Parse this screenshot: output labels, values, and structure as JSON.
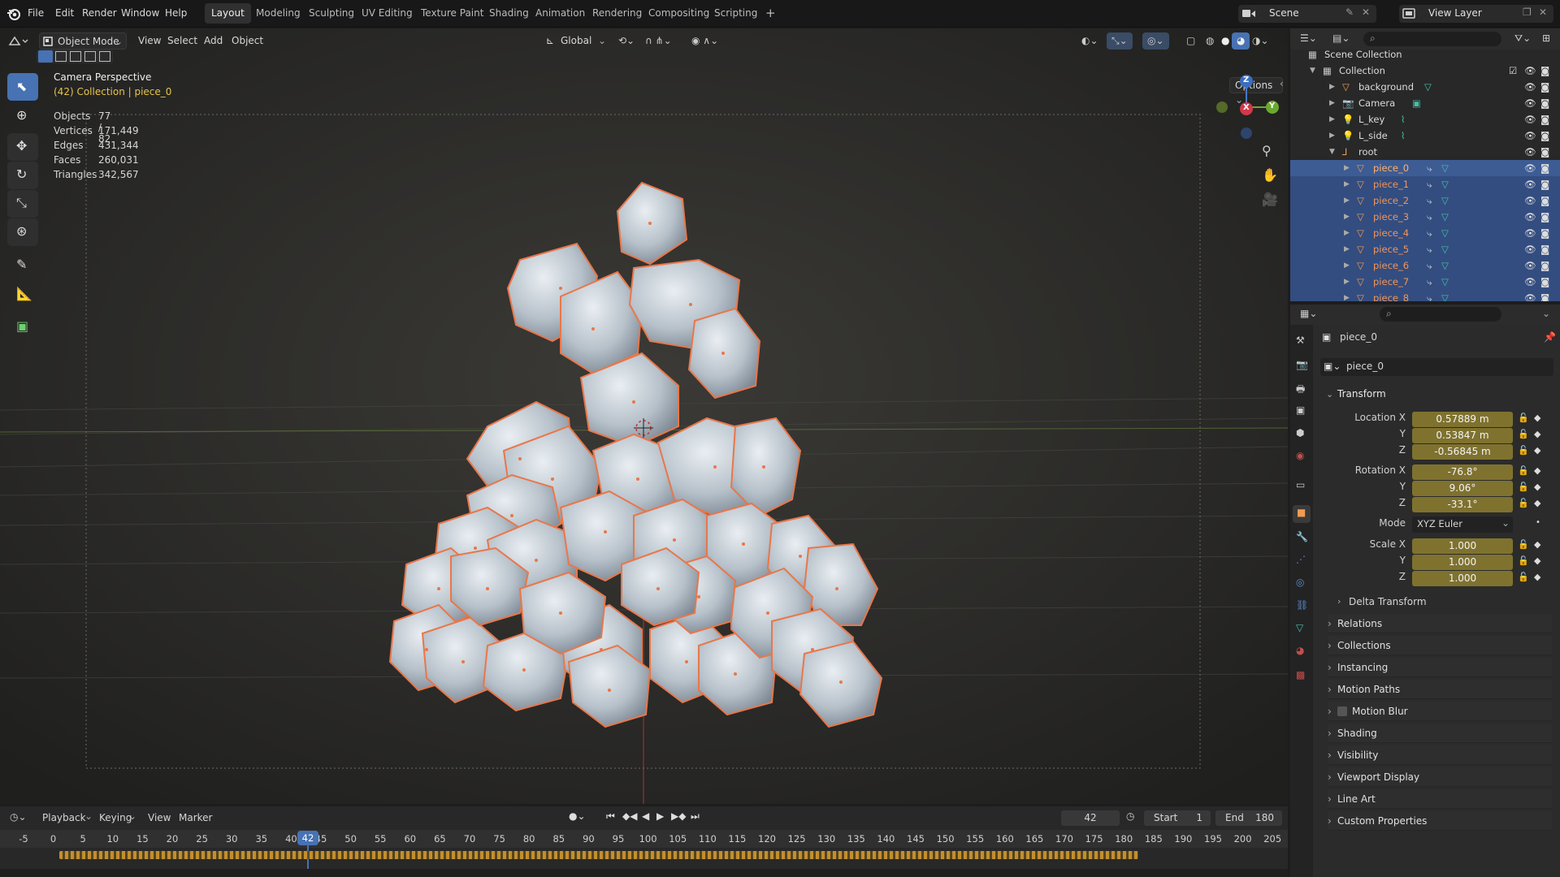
{
  "topbar": {
    "menus": [
      "File",
      "Edit",
      "Render",
      "Window",
      "Help"
    ],
    "workspaces": [
      "Layout",
      "Modeling",
      "Sculpting",
      "UV Editing",
      "Texture Paint",
      "Shading",
      "Animation",
      "Rendering",
      "Compositing",
      "Scripting"
    ],
    "active_workspace": "Layout",
    "add_tab": "+",
    "scene_label": "Scene",
    "view_layer_label": "View Layer"
  },
  "viewport_header": {
    "mode": "Object Mode",
    "menus": [
      "View",
      "Select",
      "Add",
      "Object"
    ],
    "orientation": "Global",
    "options": "Options"
  },
  "viewport": {
    "camera_title": "Camera Perspective",
    "collection_line": "(42) Collection | piece_0",
    "stats": [
      {
        "label": "Objects",
        "value": "77 / 82"
      },
      {
        "label": "Vertices",
        "value": "171,449"
      },
      {
        "label": "Edges",
        "value": "431,344"
      },
      {
        "label": "Faces",
        "value": "260,031"
      },
      {
        "label": "Triangles",
        "value": "342,567"
      }
    ],
    "gizmo": {
      "x": "X",
      "y": "Y",
      "z": "Z"
    }
  },
  "outliner": {
    "scene_collection": "Scene Collection",
    "collection": "Collection",
    "items": [
      {
        "name": "background",
        "type": "mesh"
      },
      {
        "name": "Camera",
        "type": "camera"
      },
      {
        "name": "L_key",
        "type": "light"
      },
      {
        "name": "L_side",
        "type": "light"
      },
      {
        "name": "root",
        "type": "empty"
      },
      {
        "name": "piece_0",
        "type": "mesh"
      },
      {
        "name": "piece_1",
        "type": "mesh"
      },
      {
        "name": "piece_2",
        "type": "mesh"
      },
      {
        "name": "piece_3",
        "type": "mesh"
      },
      {
        "name": "piece_4",
        "type": "mesh"
      },
      {
        "name": "piece_5",
        "type": "mesh"
      },
      {
        "name": "piece_6",
        "type": "mesh"
      },
      {
        "name": "piece_7",
        "type": "mesh"
      },
      {
        "name": "piece_8",
        "type": "mesh"
      }
    ]
  },
  "properties": {
    "object_name": "piece_0",
    "data_name": "piece_0",
    "transform_title": "Transform",
    "location": {
      "label": "Location X",
      "x": "0.57889 m",
      "y": "0.53847 m",
      "z": "-0.56845 m"
    },
    "rotation": {
      "label": "Rotation X",
      "x": "-76.8°",
      "y": "9.06°",
      "z": "-33.1°"
    },
    "mode_label": "Mode",
    "mode_value": "XYZ Euler",
    "scale": {
      "label": "Scale X",
      "x": "1.000",
      "y": "1.000",
      "z": "1.000"
    },
    "axis_y": "Y",
    "axis_z": "Z",
    "delta": "Delta Transform",
    "sections": [
      "Relations",
      "Collections",
      "Instancing",
      "Motion Paths",
      "Motion Blur",
      "Shading",
      "Visibility",
      "Viewport Display",
      "Line Art",
      "Custom Properties"
    ]
  },
  "timeline": {
    "menus": [
      "Playback",
      "Keying",
      "View",
      "Marker"
    ],
    "current_frame": "42",
    "start_label": "Start",
    "start_value": "1",
    "end_label": "End",
    "end_value": "180",
    "ruler": [
      "-5",
      "0",
      "5",
      "10",
      "15",
      "20",
      "25",
      "30",
      "35",
      "40",
      "45",
      "50",
      "55",
      "60",
      "65",
      "70",
      "75",
      "80",
      "85",
      "90",
      "95",
      "100",
      "105",
      "110",
      "115",
      "120",
      "125",
      "130",
      "135",
      "140",
      "145",
      "150",
      "155",
      "160",
      "165",
      "170",
      "175",
      "180",
      "185",
      "190",
      "195",
      "200",
      "205"
    ]
  },
  "colors": {
    "accent": "#4772b3",
    "selection_outline": "#e87b4f",
    "field_gold": "#7f722f",
    "outliner_selected": "#334d80"
  }
}
